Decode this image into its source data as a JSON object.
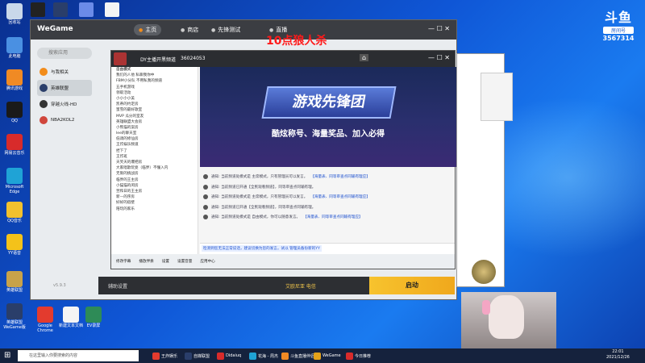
{
  "overlay": {
    "title": "10点狼人杀"
  },
  "watermark": {
    "logo": "斗鱼",
    "tag": "房间号",
    "room": "3567314"
  },
  "desktop_icons": [
    {
      "label": "回收站",
      "color": "#c9d8ea"
    },
    {
      "label": "此电脑",
      "color": "#4a90e2"
    },
    {
      "label": "腾讯游戏",
      "color": "#f08a24"
    },
    {
      "label": "QQ",
      "color": "#1a1a1a"
    },
    {
      "label": "网易云音乐",
      "color": "#d82b2b"
    },
    {
      "label": "Microsoft Edge",
      "color": "#1fa3d6"
    },
    {
      "label": "QQ音乐",
      "color": "#f2c12e"
    },
    {
      "label": "YY语音",
      "color": "#f4c21a"
    },
    {
      "label": "英雄联盟",
      "color": "#c8a24a"
    },
    {
      "label": "英雄联盟 WeGame版",
      "color": "#2a3e6a"
    }
  ],
  "bottom_icons": [
    {
      "label": "Google Chrome",
      "color": "#e33b2e"
    },
    {
      "label": "新建文本文档",
      "color": "#f4f4f4"
    },
    {
      "label": "EV录屏",
      "color": "#2e8b57"
    }
  ],
  "wegame": {
    "logo": "WeGame",
    "nav": [
      {
        "icon": "home-icon",
        "label": "主页",
        "active": true
      },
      {
        "icon": "store-icon",
        "label": "商店",
        "active": false
      },
      {
        "icon": "test-icon",
        "label": "先锋测试",
        "active": false
      },
      {
        "icon": "live-icon",
        "label": "直播",
        "active": false
      }
    ],
    "search_placeholder": "搜索应用",
    "sidebar": [
      {
        "label": "与我相关",
        "color": "#f28c1b",
        "selected": false
      },
      {
        "label": "英雄联盟",
        "color": "#2a3e6a",
        "selected": true
      },
      {
        "label": "穿越火线-HD",
        "color": "#333",
        "selected": false
      },
      {
        "label": "NBA2KOL2",
        "color": "#d0463c",
        "selected": false
      }
    ],
    "version": "v5.9.3",
    "bottom_left": "辅助设置",
    "bottom_mid": "艾欧尼亚 电信",
    "launch": "启动"
  },
  "stream": {
    "title": "DY主播开黑频道",
    "room_id": "36024053",
    "list_header": "自由模式",
    "list_rows": [
      "我们的人他 私聊我你中",
      "FBM小分队 不用私我的频道",
      "五手机游戏",
      "领取活动",
      "小小小小美",
      "凯蒂的约定房",
      "蜜雪的最好歌室",
      "MVP 瓜分的室友",
      "英雄联盟大会房",
      "小熊猫的案房",
      "lee的聊天室",
      "低调的修仙房",
      "王炸娱乐频道",
      "捏下了",
      "王炸班",
      "天笑天的爆把房",
      "大家唱歌玩耍（临界）不懂入内",
      "无限的挑战房",
      "临界的王主房",
      "小猫猫的闲房",
      "翌和日的王主房",
      "新—的序房",
      "好好的宿壁",
      "陪玩的家乐"
    ],
    "banner_title": "游戏先锋团",
    "banner_sub": "酷炫称号、海量奖品、加入必得",
    "notices": [
      {
        "text": "通知: 当前频道处模式是 主席模式，只有管理员可以发言。",
        "link": "【海量表、同等审查点同输有理应】"
      },
      {
        "text": "通知: 当前频道已开通【全民观看频道】，同等审查点同输有理。",
        "link": ""
      },
      {
        "text": "通知: 当前频道处模式是 主席模式，只有管理员可以发言。",
        "link": "【海量表、同等审查点同输有理应】"
      },
      {
        "text": "通知: 当前频道已开通【全民观看频道】，同等审查点同输有理。",
        "link": ""
      },
      {
        "text": "通知: 当前频道处模式是 自由模式，你可以随意发言。",
        "link": "【海量表、同等审查点同输有理应】"
      }
    ],
    "input_hint": "检测到您无法正常说话，建议切换为您的发言。试以 管理员备份新的YY",
    "tools": [
      "修改字幕",
      "播放伴奏",
      "设置",
      "设置音量",
      "应用中心"
    ]
  },
  "taskbar": {
    "search_placeholder": "在这里输入你要搜索的内容",
    "items": [
      "王炸娱乐",
      "自媒联盟",
      "Didaiuq",
      "花海 - 周杰",
      "斗鱼直播伴侣",
      "WeGame",
      "今日推荐"
    ],
    "time": "22:01",
    "date": "2021/12/26"
  }
}
